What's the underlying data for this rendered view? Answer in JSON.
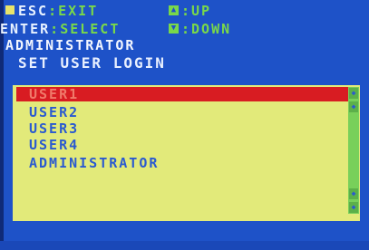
{
  "hints": {
    "esc_key": "ESC",
    "esc_action": "EXIT",
    "enter_key": "ENTER",
    "enter_action": "SELECT",
    "up_action": "UP",
    "down_action": "DOWN"
  },
  "header": {
    "title": "ADMINISTRATOR",
    "subtitle": "SET USER LOGIN"
  },
  "users": {
    "items": [
      "USER1",
      "USER2",
      "USER3",
      "USER4",
      "ADMINISTRATOR"
    ],
    "selected_index": 0
  },
  "icons": {
    "up_arrow": "up-arrow-icon",
    "down_arrow": "down-arrow-icon"
  },
  "colors": {
    "background": "#1e52c8",
    "list_panel": "#e2ea7a",
    "selection": "#d81c22",
    "hint_text": "#79d84a",
    "scrollbar": "#78d05a"
  }
}
